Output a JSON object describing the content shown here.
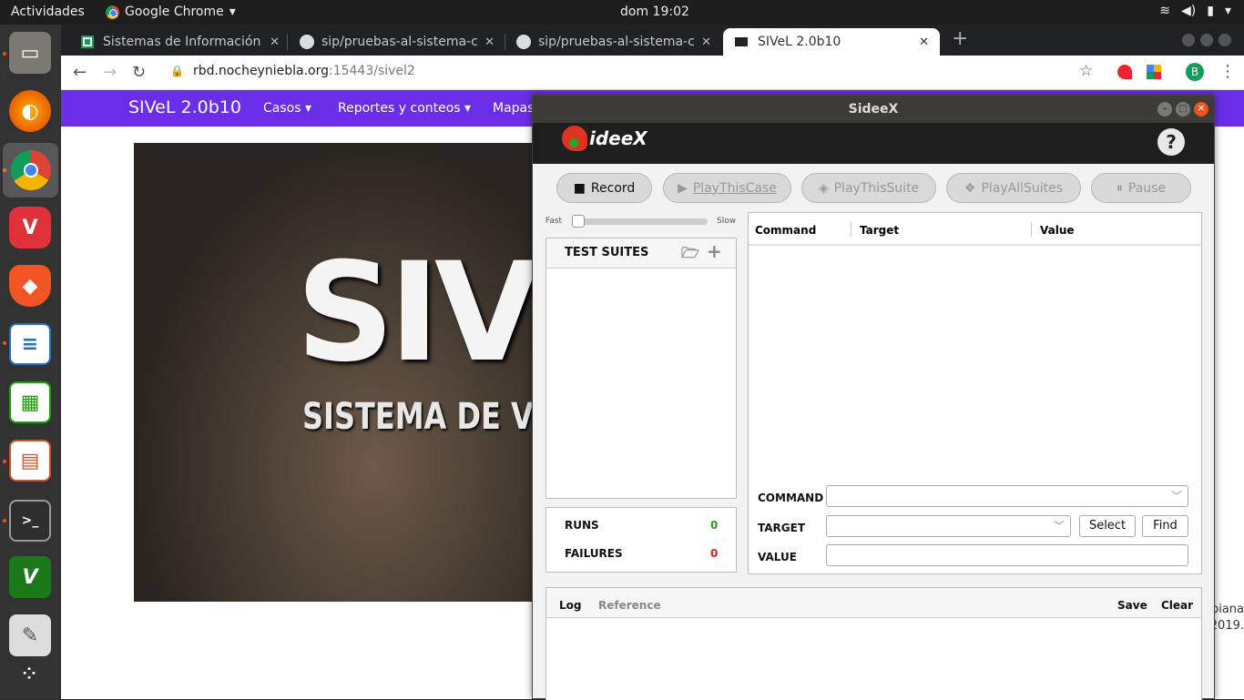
{
  "topbar": {
    "activities": "Actividades",
    "app_name": "Google Chrome",
    "clock": "dom 19:02"
  },
  "dock": {
    "items": [
      "files-icon",
      "firefox-icon",
      "chrome-icon",
      "vivaldi-icon",
      "brave-icon",
      "writer-icon",
      "calc-icon",
      "impress-icon",
      "terminal-icon",
      "vim-icon",
      "notes-icon",
      "apps-grid-icon"
    ]
  },
  "browser": {
    "tabs": [
      {
        "title": "Sistemas de Información de",
        "active": false
      },
      {
        "title": "sip/pruebas-al-sistema-co",
        "active": false
      },
      {
        "title": "sip/pruebas-al-sistema-co",
        "active": false
      },
      {
        "title": "SIVeL 2.0b10",
        "active": true
      }
    ],
    "url_host": "rbd.nocheyniebla.org",
    "url_rest": ":15443/sivel2",
    "profile_initial": "B"
  },
  "site": {
    "brand": "SIVeL 2.0b10",
    "nav": [
      {
        "label": "Casos ▾"
      },
      {
        "label": "Reportes y conteos ▾"
      },
      {
        "label": "Mapas"
      }
    ],
    "hero_big": "SIV",
    "hero_sub": "SISTEMA DE VIO",
    "footer_line1": "biana",
    "footer_line2": "2019."
  },
  "sideex": {
    "window_title": "SideeX",
    "logo_text": "ideeX",
    "help": "?",
    "buttons": {
      "record": "Record",
      "play_case": "PlayThisCase",
      "play_suite": "PlayThisSuite",
      "play_all": "PlayAllSuites",
      "pause": "Pause"
    },
    "speed": {
      "fast": "Fast",
      "slow": "Slow",
      "level": 0
    },
    "test_suites": "TEST SUITES",
    "runs_label": "RUNS",
    "runs_value": "0",
    "failures_label": "FAILURES",
    "failures_value": "0",
    "table": {
      "col_command": "Command",
      "col_target": "Target",
      "col_value": "Value"
    },
    "editor": {
      "command_label": "COMMAND",
      "target_label": "TARGET",
      "value_label": "VALUE",
      "select_btn": "Select",
      "find_btn": "Find"
    },
    "log": {
      "tab_log": "Log",
      "tab_reference": "Reference",
      "save": "Save",
      "clear": "Clear"
    },
    "colors": {
      "runs": "#2a9d2a",
      "failures": "#d22"
    }
  }
}
